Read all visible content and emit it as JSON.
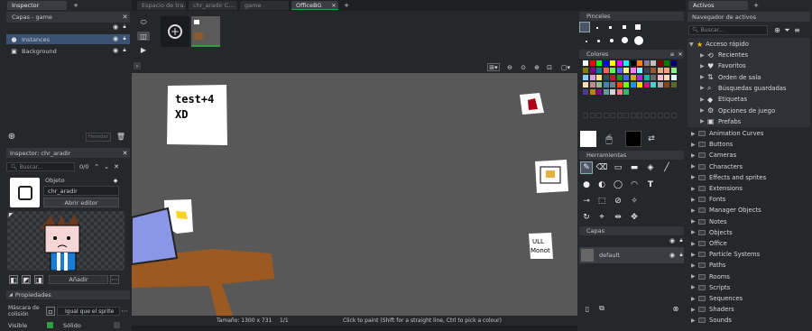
{
  "inspector": {
    "tab_label": "Inspector",
    "layers_header": "Capas - game",
    "layers": [
      {
        "name": "Instances",
        "icon": "instances-icon"
      },
      {
        "name": "Background",
        "icon": "background-icon"
      }
    ],
    "heredar_label": "Heredar",
    "sub_header": "Inspector: chr_aradir",
    "search_placeholder": "Buscar...",
    "count": "0/0",
    "object_label": "Objeto",
    "object_name": "chr_aradir",
    "open_editor_label": "Abrir editor",
    "add_label": "Añadir",
    "props_header": "Propiedades",
    "collision_label": "Máscara de colisión",
    "collision_value": "Igual que el sprite",
    "visible_label": "Visible",
    "solid_label": "Sólido"
  },
  "editor": {
    "tabs": [
      {
        "label": "Espacio de tra…"
      },
      {
        "label": "chr_aradir C…"
      },
      {
        "label": "game"
      },
      {
        "label": "OfficeBG"
      }
    ],
    "status_size": "Tamaño: 1300 x 731",
    "status_page": "1/1",
    "status_hint": "Click to paint (Shift for a straight line, Ctrl to pick a colour)",
    "canvas_labels": {
      "note_text_1": "test+4",
      "note_text_2": "XD",
      "sticker_text_1": "ULL",
      "sticker_text_2": "Monot"
    }
  },
  "brushes": {
    "header": "Pinceles",
    "colors_header": "Colores",
    "tools_header": "Herramientas",
    "layers_header": "Capas",
    "layer_name": "default",
    "palette": [
      "#ffffff",
      "#ff0000",
      "#00ff00",
      "#0000ff",
      "#ffff00",
      "#ff00ff",
      "#00ffff",
      "#000000",
      "#ff8000",
      "#808080",
      "#c0c0c0",
      "#800000",
      "#008000",
      "#000080",
      "#808000",
      "#800080",
      "#008080",
      "#ff6060",
      "#60ff60",
      "#6060ff",
      "#ffff80",
      "#ff80ff",
      "#80ffff",
      "#404040",
      "#a0522d",
      "#d2b48c",
      "#ffa07a",
      "#90ee90",
      "#87cefa",
      "#dda0dd",
      "#f0e68c",
      "#2f4f4f",
      "#b22222",
      "#228b22",
      "#4169e1",
      "#daa520",
      "#9932cc",
      "#20b2aa",
      "#696969",
      "#ffc0cb",
      "#ffdab9",
      "#e0ffff",
      "#f5deb3",
      "#bc8f8f",
      "#8fbc8f",
      "#4682b4",
      "#708090",
      "#ff4500",
      "#7cfc00",
      "#1e90ff",
      "#ffd700",
      "#c71585",
      "#48d1cc",
      "#a9a9a9",
      "#8b4513",
      "#556b2f",
      "#483d8b",
      "#b8860b",
      "#8b008b",
      "#5f9ea0",
      "#d3d3d3",
      "#f08080",
      "#3cb371"
    ]
  },
  "assets": {
    "tab_label": "Activos",
    "nav_header": "Navegador de activos",
    "search_placeholder": "Buscar...",
    "quick_access": "Acceso rápido",
    "quick_items": [
      {
        "label": "Recientes",
        "icon": "recent-icon"
      },
      {
        "label": "Favoritos",
        "icon": "heart-icon"
      },
      {
        "label": "Orden de sala",
        "icon": "room-order-icon"
      },
      {
        "label": "Búsquedas guardadas",
        "icon": "search-icon"
      },
      {
        "label": "Etiquetas",
        "icon": "tag-icon"
      },
      {
        "label": "Opciones de juego",
        "icon": "settings-icon"
      },
      {
        "label": "Prefabs",
        "icon": "prefab-icon"
      }
    ],
    "folders": [
      "Animation Curves",
      "Buttons",
      "Cameras",
      "Characters",
      "Effects and sprites",
      "Extensions",
      "Fonts",
      "Manager Objects",
      "Notes",
      "Objects",
      "Office",
      "Particle Systems",
      "Paths",
      "Rooms",
      "Scripts",
      "Sequences",
      "Shaders",
      "Sounds"
    ]
  }
}
